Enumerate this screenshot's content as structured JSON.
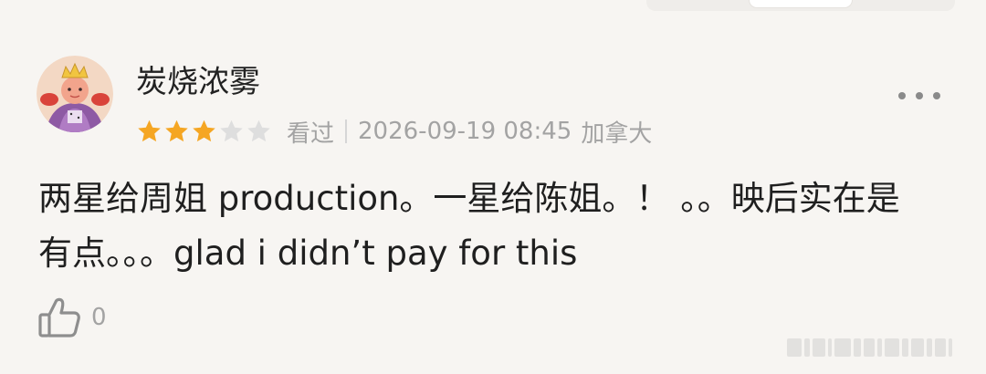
{
  "review": {
    "username": "炭烧浓雾",
    "rating": 3,
    "max_rating": 5,
    "status": "看过",
    "datetime": "2026-09-19 08:45",
    "location": "加拿大",
    "body": "两星给周姐 production。一星给陈姐。！ 。。映后实在是有点。。。glad i didn’t pay for this",
    "likes": "0"
  },
  "icons": {
    "more": "more-dots-icon",
    "like": "thumbs-up-icon",
    "star": "star-icon"
  },
  "colors": {
    "star_filled": "#f5a623",
    "star_empty": "#dedede",
    "meta_text": "#a3a3a3",
    "body_text": "#1f1f1f",
    "background": "#f7f5f2"
  }
}
